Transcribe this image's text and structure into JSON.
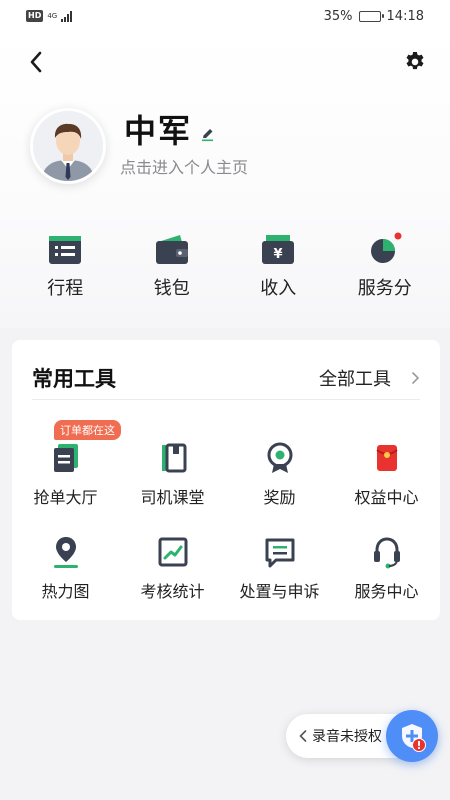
{
  "status_bar": {
    "hd": "HD",
    "network": "4G",
    "battery_percent": "35%",
    "battery_level": 0.35,
    "time": "14:18"
  },
  "nav": {
    "back_icon": "chevron-left-icon",
    "settings_icon": "gear-icon"
  },
  "profile": {
    "name": "中军",
    "link_text": "点击进入个人主页"
  },
  "quick_items": [
    {
      "label": "行程",
      "icon": "itinerary-icon"
    },
    {
      "label": "钱包",
      "icon": "wallet-icon"
    },
    {
      "label": "收入",
      "icon": "income-icon"
    },
    {
      "label": "服务分",
      "icon": "service-score-icon"
    }
  ],
  "tools": {
    "title": "常用工具",
    "all_label": "全部工具",
    "items": [
      {
        "label": "抢单大厅",
        "badge": "订单都在这",
        "icon": "order-hall-icon"
      },
      {
        "label": "司机课堂",
        "icon": "book-icon"
      },
      {
        "label": "奖励",
        "icon": "reward-icon"
      },
      {
        "label": "权益中心",
        "icon": "red-envelope-icon"
      },
      {
        "label": "热力图",
        "icon": "location-pin-icon"
      },
      {
        "label": "考核统计",
        "icon": "chart-icon"
      },
      {
        "label": "处置与申诉",
        "icon": "message-icon"
      },
      {
        "label": "服务中心",
        "icon": "headset-icon"
      }
    ]
  },
  "floating": {
    "recording_text": "录音未授权",
    "fab_icon": "shield-plus-icon"
  },
  "colors": {
    "accent_green": "#2db36f",
    "dark_icon": "#3a4150",
    "badge_orange": "#f16d52",
    "fab_blue": "#4f8ef7",
    "alert_red": "#e8332f"
  }
}
